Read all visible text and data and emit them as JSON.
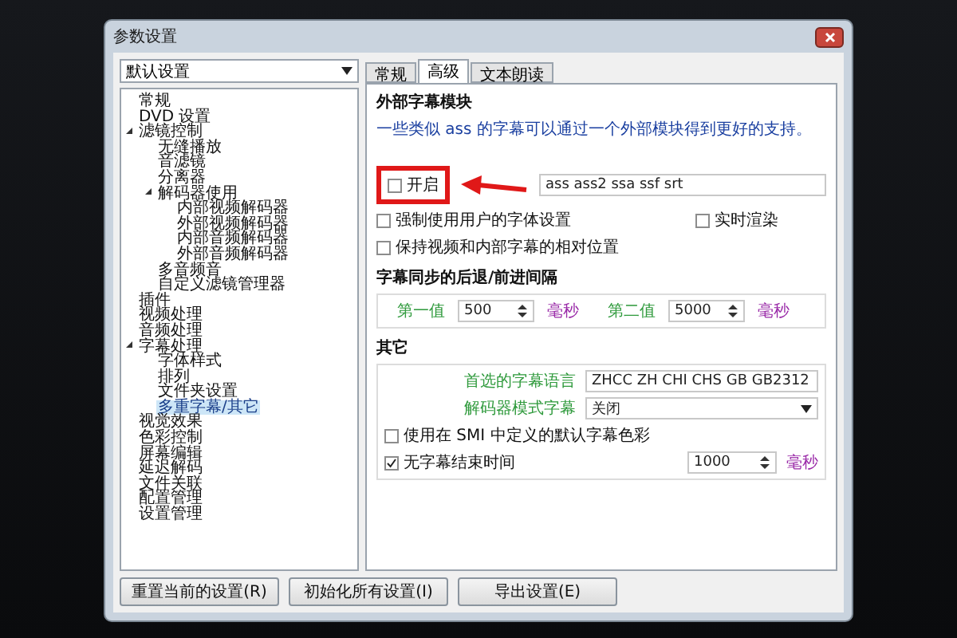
{
  "window": {
    "title": "参数设置"
  },
  "profile": {
    "value": "默认设置"
  },
  "tree": [
    {
      "label": "常规",
      "selected": false
    },
    {
      "label": "DVD 设置",
      "selected": false
    },
    {
      "label": "滤镜控制",
      "selected": false,
      "expanded": true,
      "children": [
        {
          "label": "无缝播放",
          "selected": false
        },
        {
          "label": "音滤镜",
          "selected": false
        },
        {
          "label": "分离器",
          "selected": false
        },
        {
          "label": "解码器使用",
          "selected": false,
          "expanded": true,
          "children": [
            {
              "label": "内部视频解码器",
              "selected": false
            },
            {
              "label": "外部视频解码器",
              "selected": false
            },
            {
              "label": "内部音频解码器",
              "selected": false
            },
            {
              "label": "外部音频解码器",
              "selected": false
            }
          ]
        },
        {
          "label": "多音频音",
          "selected": false
        },
        {
          "label": "自定义滤镜管理器",
          "selected": false
        }
      ]
    },
    {
      "label": "插件",
      "selected": false
    },
    {
      "label": "视频处理",
      "selected": false
    },
    {
      "label": "音频处理",
      "selected": false
    },
    {
      "label": "字幕处理",
      "selected": false,
      "expanded": true,
      "children": [
        {
          "label": "字体样式",
          "selected": false
        },
        {
          "label": "排列",
          "selected": false
        },
        {
          "label": "文件夹设置",
          "selected": false
        },
        {
          "label": "多重字幕/其它",
          "selected": true
        }
      ]
    },
    {
      "label": "视觉效果",
      "selected": false
    },
    {
      "label": "色彩控制",
      "selected": false
    },
    {
      "label": "屏幕编辑",
      "selected": false
    },
    {
      "label": "延迟解码",
      "selected": false
    },
    {
      "label": "文件关联",
      "selected": false
    },
    {
      "label": "配置管理",
      "selected": false
    },
    {
      "label": "设置管理",
      "selected": false
    }
  ],
  "tabs": [
    {
      "label": "常规",
      "selected": false
    },
    {
      "label": "高级",
      "selected": true
    },
    {
      "label": "文本朗读",
      "selected": false
    }
  ],
  "external_module": {
    "title": "外部字幕模块",
    "description": "一些类似 ass 的字幕可以通过一个外部模块得到更好的支持。",
    "enable": {
      "label": "开启",
      "checked": false
    },
    "formats": "ass  ass2  ssa  ssf  srt",
    "force_font": {
      "label": "强制使用用户的字体设置",
      "checked": false
    },
    "realtime": {
      "label": "实时渲染",
      "checked": false
    },
    "keep_position": {
      "label": "保持视频和内部字幕的相对位置",
      "checked": false
    }
  },
  "sync": {
    "title": "字幕同步的后退/前进间隔",
    "first_label": "第一值",
    "first_value": "500",
    "first_unit": "毫秒",
    "second_label": "第二值",
    "second_value": "5000",
    "second_unit": "毫秒"
  },
  "other": {
    "title": "其它",
    "language_label": "首选的字幕语言",
    "language_value": "ZHCC ZH CHI CHS GB GB2312",
    "decoder_label": "解码器模式字幕",
    "decoder_value": "关闭",
    "smi_colors": {
      "label": "使用在 SMI 中定义的默认字幕色彩",
      "checked": false
    },
    "no_end": {
      "label": "无字幕结束时间",
      "checked": true
    },
    "no_end_value": "1000",
    "no_end_unit": "毫秒"
  },
  "buttons": [
    "重置当前的设置(R)",
    "初始化所有设置(I)",
    "导出设置(E)"
  ]
}
